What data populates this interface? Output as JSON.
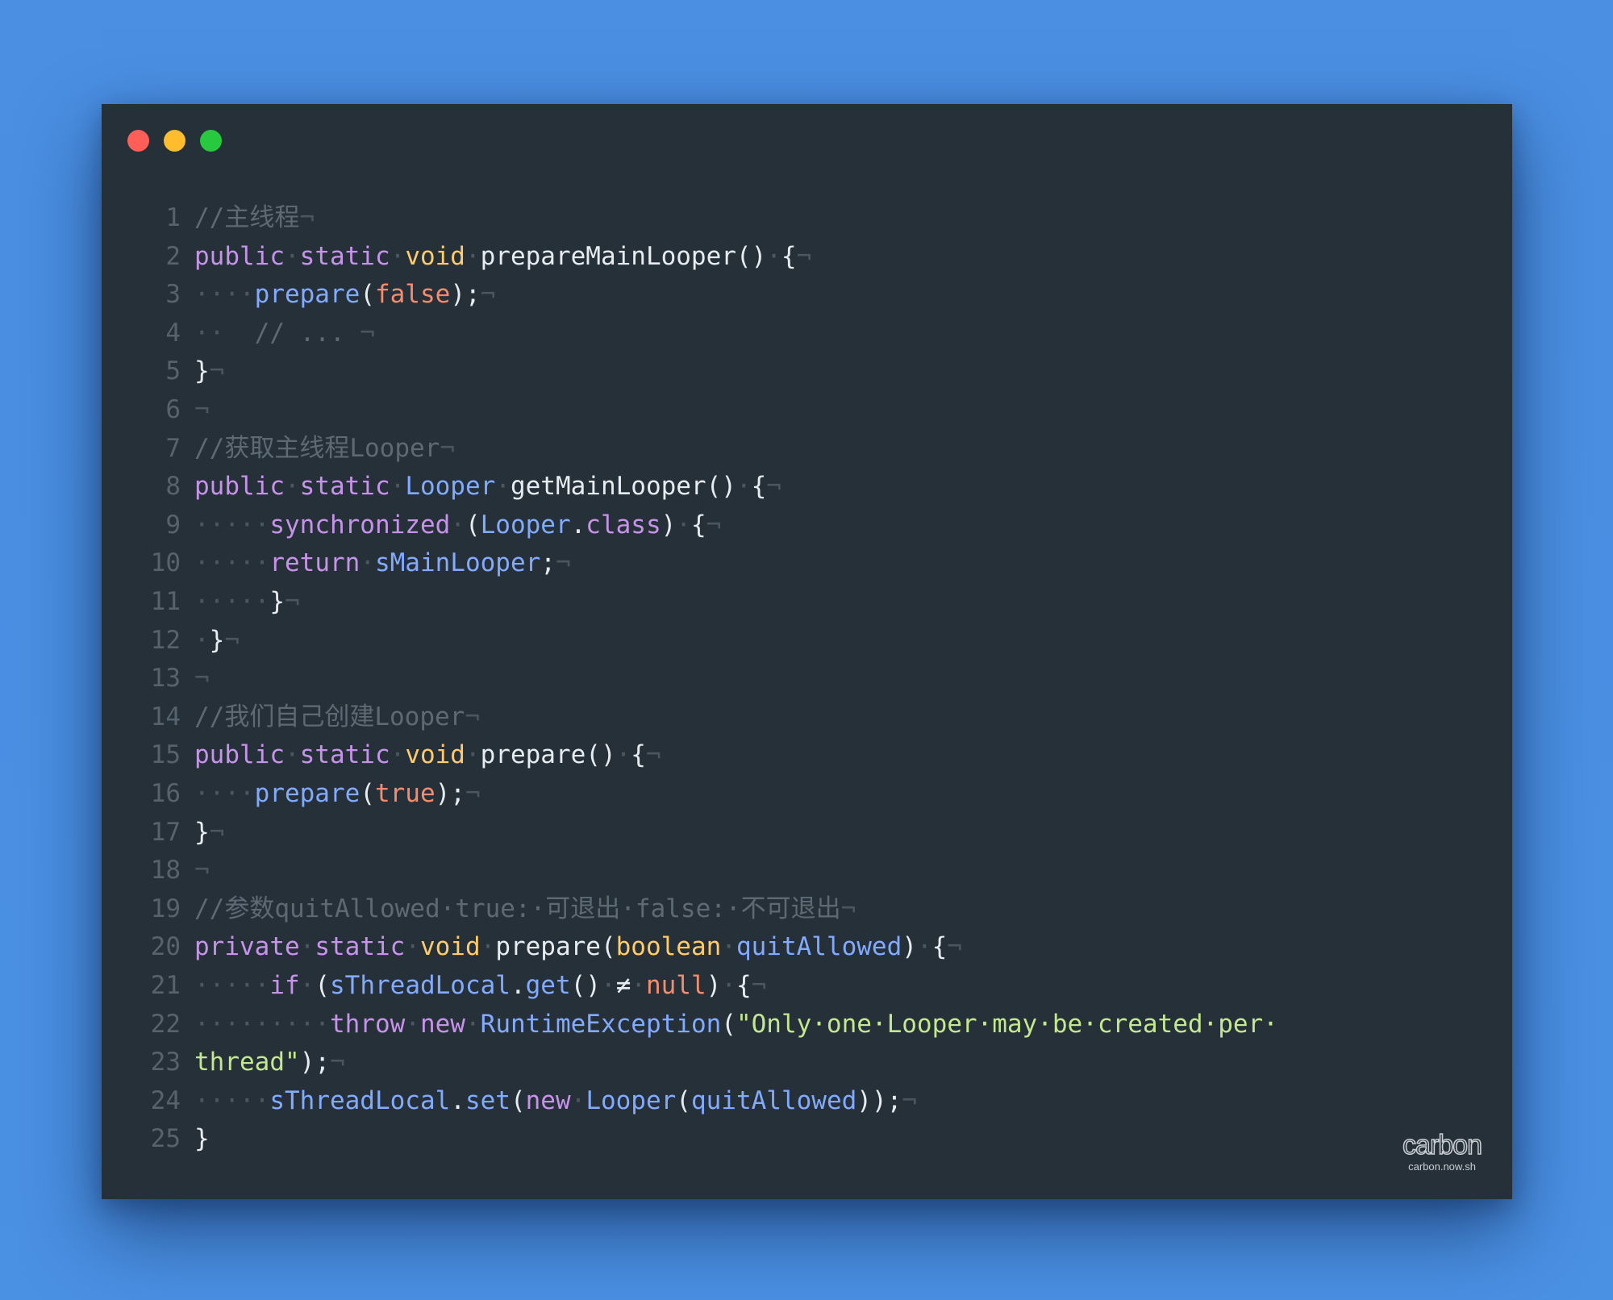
{
  "window": {
    "buttons": [
      {
        "name": "close",
        "color": "#ff5f56"
      },
      {
        "name": "minimize",
        "color": "#ffbd2e"
      },
      {
        "name": "maximize",
        "color": "#27c93f"
      }
    ]
  },
  "editor": {
    "lines": [
      {
        "number": "1",
        "tokens": [
          {
            "t": "//主线程",
            "c": "comment"
          },
          {
            "t": "¬",
            "c": "ws"
          }
        ]
      },
      {
        "number": "2",
        "tokens": [
          {
            "t": "public",
            "c": "kw"
          },
          {
            "t": "·",
            "c": "ws"
          },
          {
            "t": "static",
            "c": "kw"
          },
          {
            "t": "·",
            "c": "ws"
          },
          {
            "t": "void",
            "c": "type"
          },
          {
            "t": "·",
            "c": "ws"
          },
          {
            "t": "prepareMainLooper()",
            "c": "plain"
          },
          {
            "t": "·",
            "c": "ws"
          },
          {
            "t": "{",
            "c": "plain"
          },
          {
            "t": "¬",
            "c": "ws"
          }
        ]
      },
      {
        "number": "3",
        "tokens": [
          {
            "t": "····",
            "c": "ws"
          },
          {
            "t": "prepare",
            "c": "fn"
          },
          {
            "t": "(",
            "c": "plain"
          },
          {
            "t": "false",
            "c": "bool"
          },
          {
            "t": ");",
            "c": "plain"
          },
          {
            "t": "¬",
            "c": "ws"
          }
        ]
      },
      {
        "number": "4",
        "tokens": [
          {
            "t": "··  ",
            "c": "ws"
          },
          {
            "t": "// ...",
            "c": "comment"
          },
          {
            "t": " ¬",
            "c": "ws"
          }
        ]
      },
      {
        "number": "5",
        "tokens": [
          {
            "t": "}",
            "c": "plain"
          },
          {
            "t": "¬",
            "c": "ws"
          }
        ]
      },
      {
        "number": "6",
        "tokens": [
          {
            "t": "¬",
            "c": "ws"
          }
        ]
      },
      {
        "number": "7",
        "tokens": [
          {
            "t": "//获取主线程Looper",
            "c": "comment"
          },
          {
            "t": "¬",
            "c": "ws"
          }
        ]
      },
      {
        "number": "8",
        "tokens": [
          {
            "t": "public",
            "c": "kw"
          },
          {
            "t": "·",
            "c": "ws"
          },
          {
            "t": "static",
            "c": "kw"
          },
          {
            "t": "·",
            "c": "ws"
          },
          {
            "t": "Looper",
            "c": "cls"
          },
          {
            "t": "·",
            "c": "ws"
          },
          {
            "t": "getMainLooper()",
            "c": "plain"
          },
          {
            "t": "·",
            "c": "ws"
          },
          {
            "t": "{",
            "c": "plain"
          },
          {
            "t": "¬",
            "c": "ws"
          }
        ]
      },
      {
        "number": "9",
        "tokens": [
          {
            "t": "·····",
            "c": "ws"
          },
          {
            "t": "synchronized",
            "c": "kw"
          },
          {
            "t": "·",
            "c": "ws"
          },
          {
            "t": "(",
            "c": "plain"
          },
          {
            "t": "Looper",
            "c": "cls"
          },
          {
            "t": ".",
            "c": "plain"
          },
          {
            "t": "class",
            "c": "kw"
          },
          {
            "t": ")",
            "c": "plain"
          },
          {
            "t": "·",
            "c": "ws"
          },
          {
            "t": "{",
            "c": "plain"
          },
          {
            "t": "¬",
            "c": "ws"
          }
        ]
      },
      {
        "number": "10",
        "tokens": [
          {
            "t": "·····",
            "c": "ws"
          },
          {
            "t": "return",
            "c": "kw"
          },
          {
            "t": "·",
            "c": "ws"
          },
          {
            "t": "sMainLooper",
            "c": "fn"
          },
          {
            "t": ";",
            "c": "plain"
          },
          {
            "t": "¬",
            "c": "ws"
          }
        ]
      },
      {
        "number": "11",
        "tokens": [
          {
            "t": "·····",
            "c": "ws"
          },
          {
            "t": "}",
            "c": "plain"
          },
          {
            "t": "¬",
            "c": "ws"
          }
        ]
      },
      {
        "number": "12",
        "tokens": [
          {
            "t": "·",
            "c": "ws"
          },
          {
            "t": "}",
            "c": "plain"
          },
          {
            "t": "¬",
            "c": "ws"
          }
        ]
      },
      {
        "number": "13",
        "tokens": [
          {
            "t": "¬",
            "c": "ws"
          }
        ]
      },
      {
        "number": "14",
        "tokens": [
          {
            "t": "//我们自己创建Looper",
            "c": "comment"
          },
          {
            "t": "¬",
            "c": "ws"
          }
        ]
      },
      {
        "number": "15",
        "tokens": [
          {
            "t": "public",
            "c": "kw"
          },
          {
            "t": "·",
            "c": "ws"
          },
          {
            "t": "static",
            "c": "kw"
          },
          {
            "t": "·",
            "c": "ws"
          },
          {
            "t": "void",
            "c": "type"
          },
          {
            "t": "·",
            "c": "ws"
          },
          {
            "t": "prepare()",
            "c": "plain"
          },
          {
            "t": "·",
            "c": "ws"
          },
          {
            "t": "{",
            "c": "plain"
          },
          {
            "t": "¬",
            "c": "ws"
          }
        ]
      },
      {
        "number": "16",
        "tokens": [
          {
            "t": "····",
            "c": "ws"
          },
          {
            "t": "prepare",
            "c": "fn"
          },
          {
            "t": "(",
            "c": "plain"
          },
          {
            "t": "true",
            "c": "bool"
          },
          {
            "t": ");",
            "c": "plain"
          },
          {
            "t": "¬",
            "c": "ws"
          }
        ]
      },
      {
        "number": "17",
        "tokens": [
          {
            "t": "}",
            "c": "plain"
          },
          {
            "t": "¬",
            "c": "ws"
          }
        ]
      },
      {
        "number": "18",
        "tokens": [
          {
            "t": "¬",
            "c": "ws"
          }
        ]
      },
      {
        "number": "19",
        "tokens": [
          {
            "t": "//参数quitAllowed·true:·可退出·false:·不可退出",
            "c": "comment"
          },
          {
            "t": "¬",
            "c": "ws"
          }
        ]
      },
      {
        "number": "20",
        "tokens": [
          {
            "t": "private",
            "c": "kw"
          },
          {
            "t": "·",
            "c": "ws"
          },
          {
            "t": "static",
            "c": "kw"
          },
          {
            "t": "·",
            "c": "ws"
          },
          {
            "t": "void",
            "c": "type"
          },
          {
            "t": "·",
            "c": "ws"
          },
          {
            "t": "prepare(",
            "c": "plain"
          },
          {
            "t": "boolean",
            "c": "type"
          },
          {
            "t": "·",
            "c": "ws"
          },
          {
            "t": "quitAllowed",
            "c": "fn"
          },
          {
            "t": ")",
            "c": "plain"
          },
          {
            "t": "·",
            "c": "ws"
          },
          {
            "t": "{",
            "c": "plain"
          },
          {
            "t": "¬",
            "c": "ws"
          }
        ]
      },
      {
        "number": "21",
        "tokens": [
          {
            "t": "·····",
            "c": "ws"
          },
          {
            "t": "if",
            "c": "kw"
          },
          {
            "t": "·",
            "c": "ws"
          },
          {
            "t": "(",
            "c": "plain"
          },
          {
            "t": "sThreadLocal",
            "c": "fn"
          },
          {
            "t": ".",
            "c": "plain"
          },
          {
            "t": "get",
            "c": "fn"
          },
          {
            "t": "()",
            "c": "plain"
          },
          {
            "t": "·",
            "c": "ws"
          },
          {
            "t": "≠",
            "c": "plain"
          },
          {
            "t": "·",
            "c": "ws"
          },
          {
            "t": "null",
            "c": "bool"
          },
          {
            "t": ")",
            "c": "plain"
          },
          {
            "t": "·",
            "c": "ws"
          },
          {
            "t": "{",
            "c": "plain"
          },
          {
            "t": "¬",
            "c": "ws"
          }
        ]
      },
      {
        "number": "22",
        "tokens": [
          {
            "t": "·········",
            "c": "ws"
          },
          {
            "t": "throw",
            "c": "kw"
          },
          {
            "t": "·",
            "c": "ws"
          },
          {
            "t": "new",
            "c": "kw"
          },
          {
            "t": "·",
            "c": "ws"
          },
          {
            "t": "RuntimeException",
            "c": "cls"
          },
          {
            "t": "(",
            "c": "plain"
          },
          {
            "t": "\"Only·one·Looper·may·be·created·per·",
            "c": "str"
          }
        ]
      },
      {
        "number": "23",
        "tokens": [
          {
            "t": "thread\"",
            "c": "str"
          },
          {
            "t": ");",
            "c": "plain"
          },
          {
            "t": "¬",
            "c": "ws"
          }
        ]
      },
      {
        "number": "24",
        "tokens": [
          {
            "t": "·····",
            "c": "ws"
          },
          {
            "t": "sThreadLocal",
            "c": "fn"
          },
          {
            "t": ".",
            "c": "plain"
          },
          {
            "t": "set",
            "c": "fn"
          },
          {
            "t": "(",
            "c": "plain"
          },
          {
            "t": "new",
            "c": "kw"
          },
          {
            "t": "·",
            "c": "ws"
          },
          {
            "t": "Looper",
            "c": "cls"
          },
          {
            "t": "(",
            "c": "plain"
          },
          {
            "t": "quitAllowed",
            "c": "fn"
          },
          {
            "t": "));",
            "c": "plain"
          },
          {
            "t": "¬",
            "c": "ws"
          }
        ]
      },
      {
        "number": "25",
        "tokens": [
          {
            "t": "}",
            "c": "plain"
          }
        ]
      }
    ]
  },
  "watermark": {
    "logo": "carbon",
    "url": "carbon.now.sh"
  },
  "colors": {
    "background": "#4a90e3",
    "window": "#263039",
    "comment": "#5d6a74",
    "keyword": "#c792ea",
    "type": "#ffcb6b",
    "function": "#82aaff",
    "literal": "#f78c6c",
    "string": "#c3e88d",
    "text": "#e7ecf0"
  }
}
